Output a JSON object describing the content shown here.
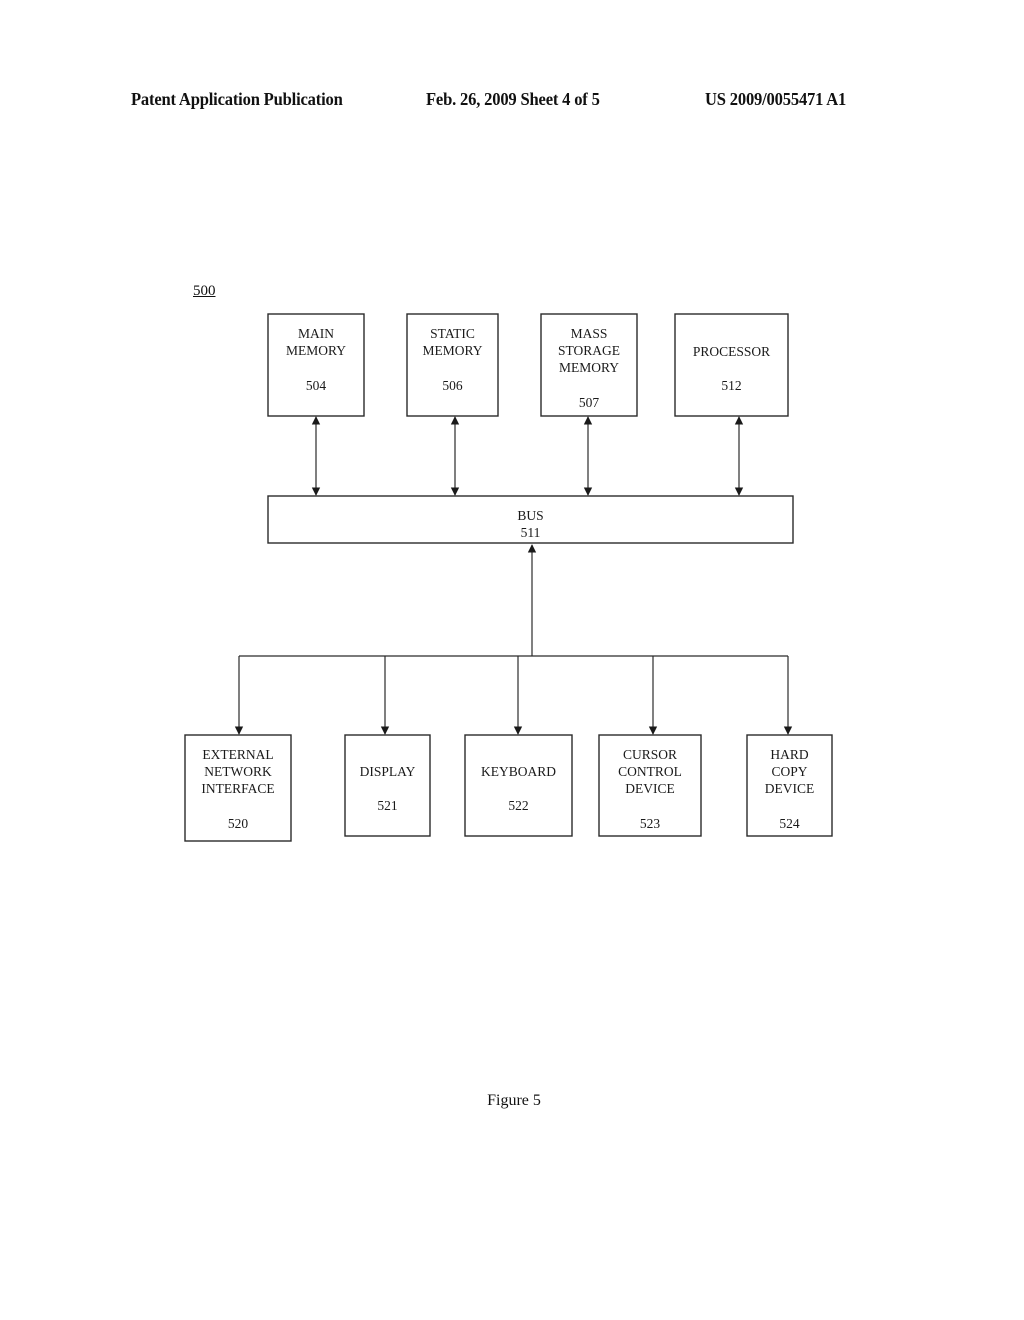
{
  "header": {
    "left": "Patent Application Publication",
    "middle": "Feb. 26, 2009   Sheet 4 of 5",
    "right": "US 2009/0055471 A1"
  },
  "figure_ref": "500",
  "caption": "Figure 5",
  "top_boxes": [
    {
      "id": "main-memory",
      "lines": [
        "MAIN",
        "MEMORY"
      ],
      "number": "504"
    },
    {
      "id": "static-memory",
      "lines": [
        "STATIC",
        "MEMORY"
      ],
      "number": "506"
    },
    {
      "id": "mass-storage-memory",
      "lines": [
        "MASS",
        "STORAGE",
        "MEMORY"
      ],
      "number": "507"
    },
    {
      "id": "processor",
      "lines": [
        "PROCESSOR"
      ],
      "number": "512"
    }
  ],
  "bus": {
    "lines": [
      "BUS"
    ],
    "number": "511"
  },
  "bottom_boxes": [
    {
      "id": "external-network-interface",
      "lines": [
        "EXTERNAL",
        "NETWORK",
        "INTERFACE"
      ],
      "number": "520"
    },
    {
      "id": "display",
      "lines": [
        "DISPLAY"
      ],
      "number": "521"
    },
    {
      "id": "keyboard",
      "lines": [
        "KEYBOARD"
      ],
      "number": "522"
    },
    {
      "id": "cursor-control-device",
      "lines": [
        "CURSOR",
        "CONTROL",
        "DEVICE"
      ],
      "number": "523"
    },
    {
      "id": "hard-copy-device",
      "lines": [
        "HARD",
        "COPY",
        "DEVICE"
      ],
      "number": "524"
    }
  ],
  "connections": {
    "top_to_bus": "bidirectional",
    "bus_to_bottom": "bus receives from shared line; shared line feeds each bottom device"
  }
}
